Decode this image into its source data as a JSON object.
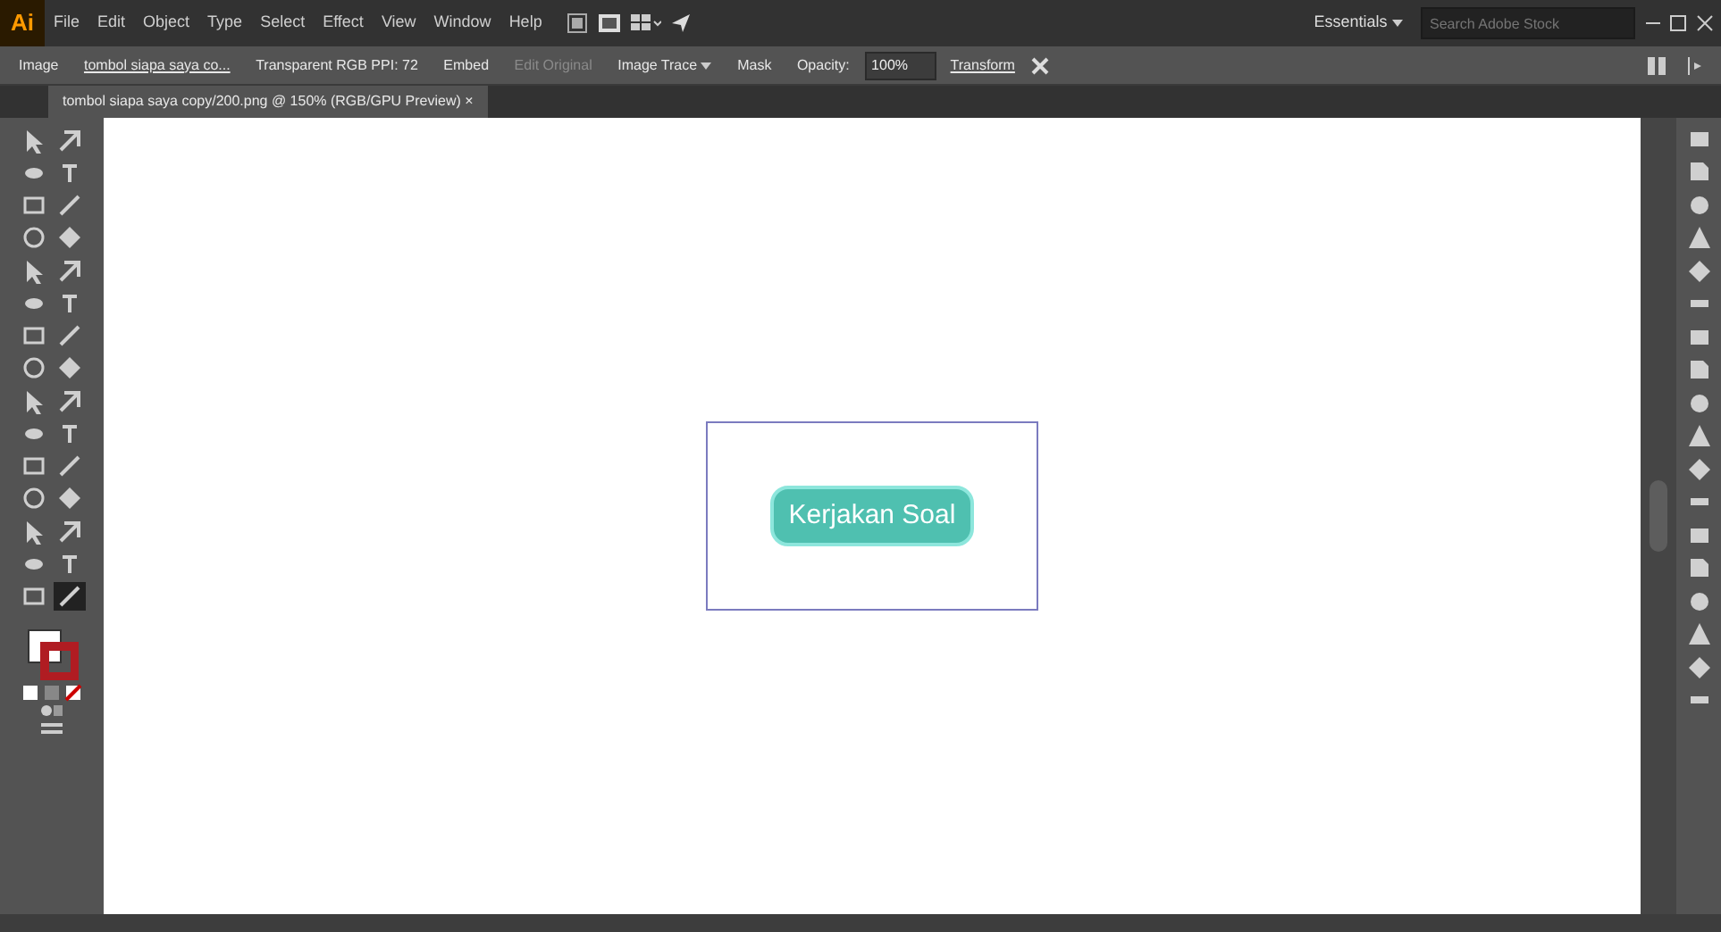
{
  "app": {
    "logo": "Ai",
    "menu": [
      "File",
      "Edit",
      "Object",
      "Type",
      "Select",
      "Effect",
      "View",
      "Window",
      "Help"
    ],
    "workspace": "Essentials",
    "search": {
      "placeholder": "Search Adobe Stock"
    }
  },
  "control_bar": [
    {
      "kind": "label",
      "text": "Image",
      "disabled": false
    },
    {
      "kind": "link",
      "text": "tombol siapa saya co...",
      "disabled": false
    },
    {
      "kind": "label",
      "text": "Transparent RGB  PPI: 72",
      "disabled": false
    },
    {
      "kind": "button",
      "text": "Embed",
      "disabled": false
    },
    {
      "kind": "button",
      "text": "Edit Original",
      "disabled": true
    },
    {
      "kind": "dropdown",
      "text": "Image Trace",
      "disabled": false
    },
    {
      "kind": "button",
      "text": "Mask",
      "disabled": false
    },
    {
      "kind": "label",
      "text": "Opacity:",
      "disabled": false
    },
    {
      "kind": "field",
      "text": "100%",
      "disabled": false
    },
    {
      "kind": "link",
      "text": "Transform",
      "disabled": false
    }
  ],
  "document_tab": {
    "title": "tombol siapa saya copy/200.png @ 150% (RGB/GPU Preview)",
    "close": "×",
    "selected": true
  },
  "tools": [
    {
      "selected": false
    },
    {
      "selected": false
    },
    {
      "selected": false
    },
    {
      "selected": false
    },
    {
      "selected": false
    },
    {
      "selected": false
    },
    {
      "selected": false
    },
    {
      "selected": false
    },
    {
      "selected": false
    },
    {
      "selected": false
    },
    {
      "selected": false
    },
    {
      "selected": false
    },
    {
      "selected": false
    },
    {
      "selected": false
    },
    {
      "selected": false
    },
    {
      "selected": false
    },
    {
      "selected": false
    },
    {
      "selected": false
    },
    {
      "selected": false
    },
    {
      "selected": false
    },
    {
      "selected": false
    },
    {
      "selected": false
    },
    {
      "selected": false
    },
    {
      "selected": false
    },
    {
      "selected": false
    },
    {
      "selected": false
    },
    {
      "selected": false
    },
    {
      "selected": false
    },
    {
      "selected": false
    },
    {
      "selected": true
    }
  ],
  "colors": [
    {
      "kind": "fill",
      "color": "#ffffff"
    },
    {
      "kind": "stroke",
      "color": "#b01c22"
    }
  ],
  "artboard": {
    "button_label": "Kerjakan Soal",
    "selected": true
  }
}
